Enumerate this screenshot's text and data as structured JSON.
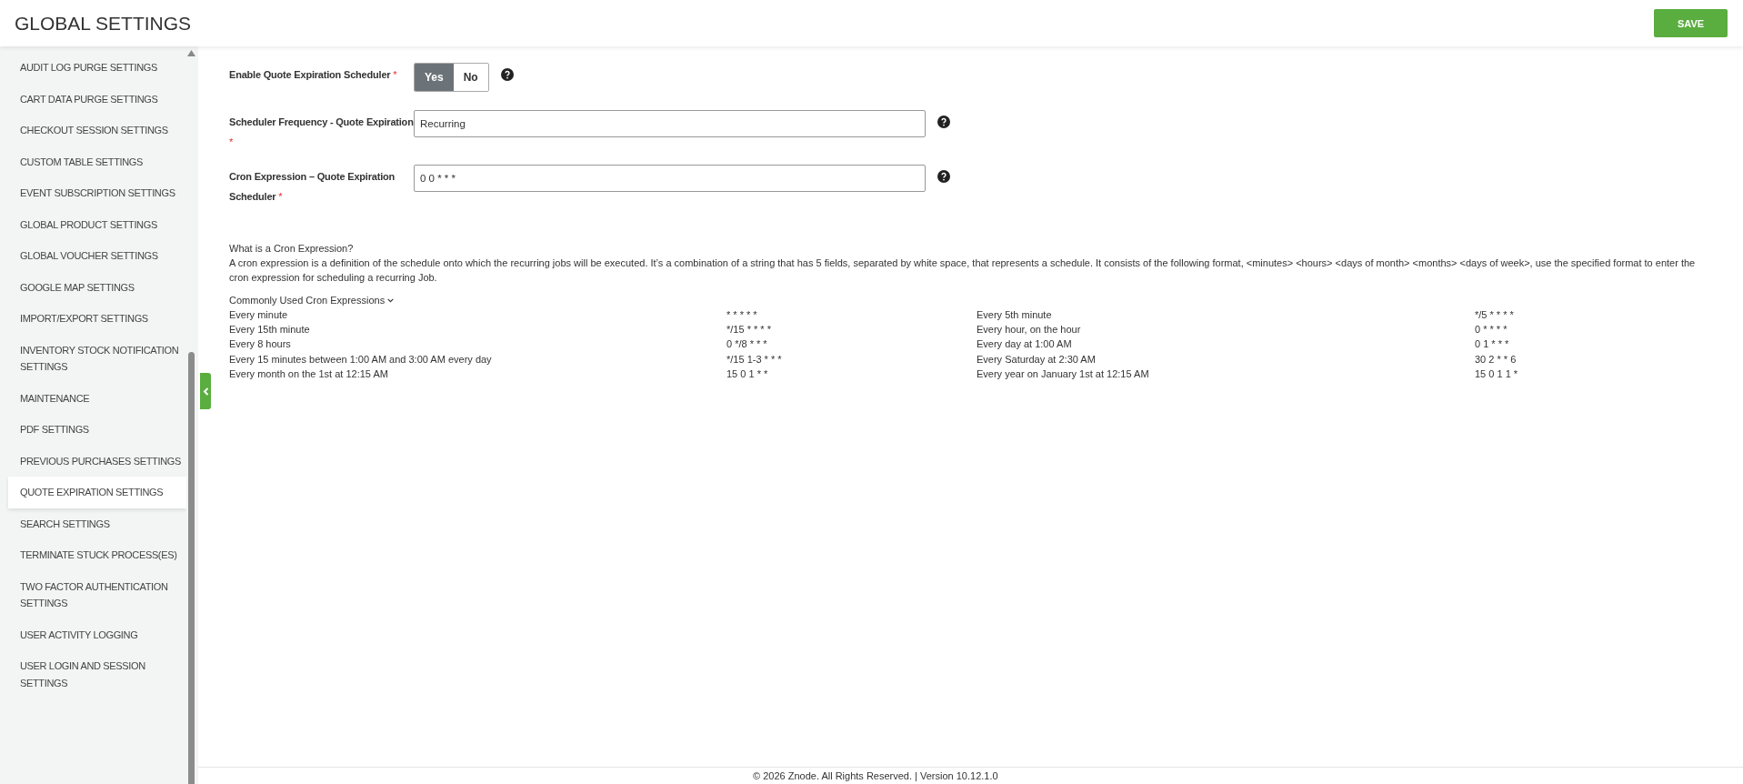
{
  "header": {
    "title": "GLOBAL SETTINGS",
    "save_button": "SAVE"
  },
  "sidebar": {
    "items": [
      {
        "label": "AUDIT LOG PURGE SETTINGS",
        "selected": false
      },
      {
        "label": "CART DATA PURGE SETTINGS",
        "selected": false
      },
      {
        "label": "CHECKOUT SESSION SETTINGS",
        "selected": false
      },
      {
        "label": "CUSTOM TABLE SETTINGS",
        "selected": false
      },
      {
        "label": "EVENT SUBSCRIPTION SETTINGS",
        "selected": false
      },
      {
        "label": "GLOBAL PRODUCT SETTINGS",
        "selected": false
      },
      {
        "label": "GLOBAL VOUCHER SETTINGS",
        "selected": false
      },
      {
        "label": "GOOGLE MAP SETTINGS",
        "selected": false
      },
      {
        "label": "IMPORT/EXPORT SETTINGS",
        "selected": false
      },
      {
        "label": "INVENTORY STOCK NOTIFICATION SETTINGS",
        "selected": false
      },
      {
        "label": "MAINTENANCE",
        "selected": false
      },
      {
        "label": "PDF SETTINGS",
        "selected": false
      },
      {
        "label": "PREVIOUS PURCHASES SETTINGS",
        "selected": false
      },
      {
        "label": "QUOTE EXPIRATION SETTINGS",
        "selected": true
      },
      {
        "label": "SEARCH SETTINGS",
        "selected": false
      },
      {
        "label": "TERMINATE STUCK PROCESS(ES)",
        "selected": false
      },
      {
        "label": "TWO FACTOR AUTHENTICATION SETTINGS",
        "selected": false
      },
      {
        "label": "USER ACTIVITY LOGGING",
        "selected": false
      },
      {
        "label": "USER LOGIN AND SESSION SETTINGS",
        "selected": false
      }
    ]
  },
  "form": {
    "fields": [
      {
        "kind": "toggle",
        "label": "Enable Quote Expiration Scheduler",
        "required": "*",
        "options": [
          {
            "label": "Yes",
            "selected": true
          },
          {
            "label": "No",
            "selected": false
          }
        ]
      },
      {
        "kind": "text",
        "label": "Scheduler Frequency - Quote Expiration",
        "required": "*",
        "value": "Recurring"
      },
      {
        "kind": "text",
        "label": "Cron Expression – Quote Expiration Scheduler",
        "required": "*",
        "value": "0 0 * * *"
      }
    ]
  },
  "help": {
    "title": "What is a Cron Expression?",
    "text": "A cron expression is a definition of the schedule onto which the recurring jobs will be executed. It’s a combination of a string that has 5 fields, separated by white space, that represents a schedule. It consists of the following format, <minutes> <hours> <days of month> <months> <days of week>, use the specified format to enter the cron expression for scheduling a recurring Job.",
    "common_heading": "Commonly Used Cron Expressions",
    "expressions": [
      [
        {
          "description": "Every minute",
          "expression": "* * * * *"
        },
        {
          "description": "Every 5th minute",
          "expression": "*/5 * * * *"
        }
      ],
      [
        {
          "description": "Every 15th minute",
          "expression": "*/15 * * * *"
        },
        {
          "description": "Every hour, on the hour",
          "expression": "0 * * * *"
        }
      ],
      [
        {
          "description": "Every 8 hours",
          "expression": "0 */8 * * *"
        },
        {
          "description": "Every day at 1:00 AM",
          "expression": "0 1 * * *"
        }
      ],
      [
        {
          "description": "Every 15 minutes between 1:00 AM and 3:00 AM every day",
          "expression": "*/15 1-3 * * *"
        },
        {
          "description": "Every Saturday at 2:30 AM",
          "expression": "30 2 * * 6"
        }
      ],
      [
        {
          "description": "Every month on the 1st at 12:15 AM",
          "expression": "15 0 1 * *"
        },
        {
          "description": "Every year on January 1st at 12:15 AM",
          "expression": "15 0 1 1 *"
        }
      ]
    ]
  },
  "footer": "© 2026 Znode. All Rights Reserved. | Version 10.12.1.0"
}
